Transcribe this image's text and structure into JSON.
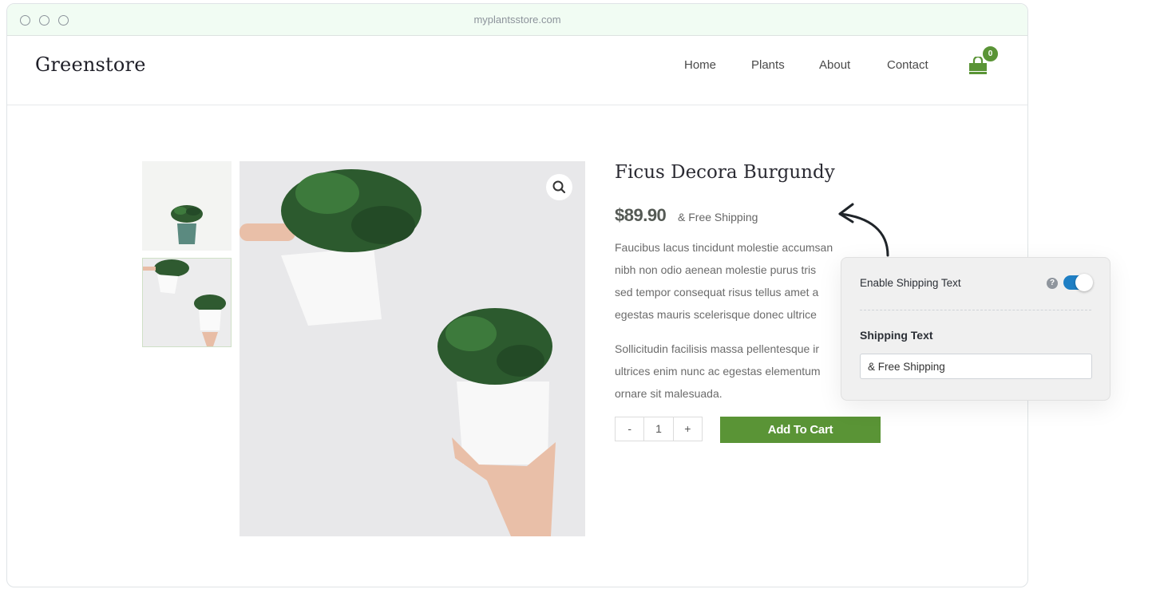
{
  "browser": {
    "url": "myplantsstore.com"
  },
  "header": {
    "logo": "Greenstore",
    "nav": [
      {
        "label": "Home"
      },
      {
        "label": "Plants"
      },
      {
        "label": "About"
      },
      {
        "label": "Contact"
      }
    ],
    "cart_count": "0",
    "cart_icon": "shopping-bag-icon",
    "accent": "#5a9436"
  },
  "product": {
    "title": "Ficus Decora Burgundy",
    "price": "$89.90",
    "shipping_text": "& Free Shipping",
    "description": [
      [
        "Faucibus lacus tincidunt molestie accumsan",
        "nibh non odio aenean molestie purus tris",
        "sed tempor consequat risus tellus amet a",
        "egestas mauris scelerisque donec ultrice"
      ],
      [
        "Sollicitudin facilisis massa pellentesque ir",
        "ultrices enim nunc ac egestas elementum",
        "ornare sit malesuada."
      ]
    ],
    "quantity": {
      "minus": "-",
      "value": "1",
      "plus": "+"
    },
    "add_to_cart": "Add To Cart",
    "zoom_icon": "magnifier-icon"
  },
  "settings_panel": {
    "enable_label": "Enable Shipping Text",
    "help_icon": "?",
    "enabled": true,
    "toggle_color": "#1f7fc4",
    "shipping_label": "Shipping Text",
    "shipping_value": "& Free Shipping"
  }
}
